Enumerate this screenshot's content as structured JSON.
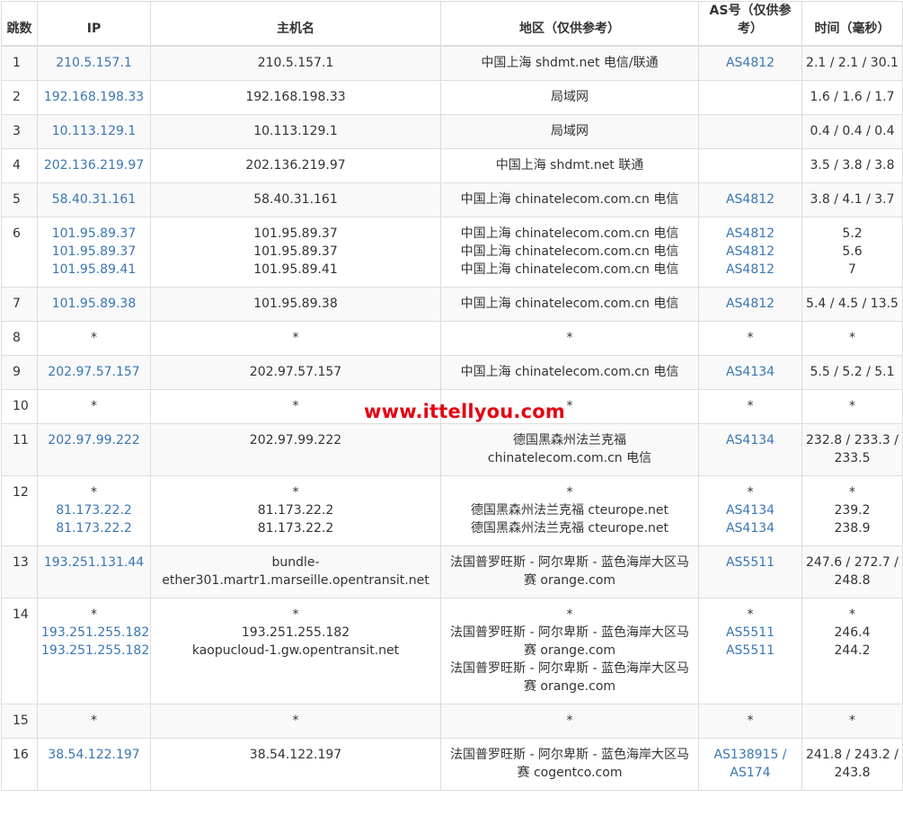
{
  "headers": {
    "hop": "跳数",
    "ip": "IP",
    "hostname": "主机名",
    "region": "地区（仅供参考）",
    "as": "AS号（仅供参考）",
    "time": "时间（毫秒）"
  },
  "watermark": "www.ittellyou.com",
  "rows": [
    {
      "hop": "1",
      "ip": [
        "210.5.157.1"
      ],
      "host": [
        "210.5.157.1"
      ],
      "region": [
        "中国上海 shdmt.net 电信/联通"
      ],
      "as": [
        "AS4812"
      ],
      "time": [
        "2.1 / 2.1 / 30.1"
      ]
    },
    {
      "hop": "2",
      "ip": [
        "192.168.198.33"
      ],
      "host": [
        "192.168.198.33"
      ],
      "region": [
        "局域网"
      ],
      "as": [
        ""
      ],
      "time": [
        "1.6 / 1.6 / 1.7"
      ]
    },
    {
      "hop": "3",
      "ip": [
        "10.113.129.1"
      ],
      "host": [
        "10.113.129.1"
      ],
      "region": [
        "局域网"
      ],
      "as": [
        ""
      ],
      "time": [
        "0.4 / 0.4 / 0.4"
      ]
    },
    {
      "hop": "4",
      "ip": [
        "202.136.219.97"
      ],
      "host": [
        "202.136.219.97"
      ],
      "region": [
        "中国上海 shdmt.net 联通"
      ],
      "as": [
        ""
      ],
      "time": [
        "3.5 / 3.8 / 3.8"
      ]
    },
    {
      "hop": "5",
      "ip": [
        "58.40.31.161"
      ],
      "host": [
        "58.40.31.161"
      ],
      "region": [
        "中国上海 chinatelecom.com.cn 电信"
      ],
      "as": [
        "AS4812"
      ],
      "time": [
        "3.8 / 4.1 / 3.7"
      ]
    },
    {
      "hop": "6",
      "ip": [
        "101.95.89.37",
        "101.95.89.37",
        "101.95.89.41"
      ],
      "host": [
        "101.95.89.37",
        "101.95.89.37",
        "101.95.89.41"
      ],
      "region": [
        "中国上海 chinatelecom.com.cn 电信",
        "中国上海 chinatelecom.com.cn 电信",
        "中国上海 chinatelecom.com.cn 电信"
      ],
      "as": [
        "AS4812",
        "AS4812",
        "AS4812"
      ],
      "time": [
        "5.2",
        "5.6",
        "7"
      ]
    },
    {
      "hop": "7",
      "ip": [
        "101.95.89.38"
      ],
      "host": [
        "101.95.89.38"
      ],
      "region": [
        "中国上海 chinatelecom.com.cn 电信"
      ],
      "as": [
        "AS4812"
      ],
      "time": [
        "5.4 / 4.5 / 13.5"
      ]
    },
    {
      "hop": "8",
      "ip": [
        "*"
      ],
      "host": [
        "*"
      ],
      "region": [
        "*"
      ],
      "as": [
        "*"
      ],
      "time": [
        "*"
      ]
    },
    {
      "hop": "9",
      "ip": [
        "202.97.57.157"
      ],
      "host": [
        "202.97.57.157"
      ],
      "region": [
        "中国上海 chinatelecom.com.cn 电信"
      ],
      "as": [
        "AS4134"
      ],
      "time": [
        "5.5 / 5.2 / 5.1"
      ]
    },
    {
      "hop": "10",
      "ip": [
        "*"
      ],
      "host": [
        "*"
      ],
      "region": [
        "*"
      ],
      "as": [
        "*"
      ],
      "time": [
        "*"
      ]
    },
    {
      "hop": "11",
      "ip": [
        "202.97.99.222"
      ],
      "host": [
        "202.97.99.222"
      ],
      "region": [
        "德国黑森州法兰克福 chinatelecom.com.cn 电信"
      ],
      "as": [
        "AS4134"
      ],
      "time": [
        "232.8 / 233.3 / 233.5"
      ]
    },
    {
      "hop": "12",
      "ip": [
        "*",
        "81.173.22.2",
        "81.173.22.2"
      ],
      "host": [
        "*",
        "81.173.22.2",
        "81.173.22.2"
      ],
      "region": [
        "*",
        "德国黑森州法兰克福 cteurope.net",
        "德国黑森州法兰克福 cteurope.net"
      ],
      "as": [
        "*",
        "AS4134",
        "AS4134"
      ],
      "time": [
        "*",
        "239.2",
        "238.9"
      ]
    },
    {
      "hop": "13",
      "ip": [
        "193.251.131.44"
      ],
      "host": [
        "bundle-ether301.martr1.marseille.opentransit.net"
      ],
      "region": [
        "法国普罗旺斯 - 阿尔卑斯 - 蓝色海岸大区马赛 orange.com"
      ],
      "as": [
        "AS5511"
      ],
      "time": [
        "247.6 / 272.7 / 248.8"
      ]
    },
    {
      "hop": "14",
      "ip": [
        "*",
        "193.251.255.182",
        "193.251.255.182"
      ],
      "host": [
        "*",
        "193.251.255.182",
        "kaopucloud-1.gw.opentransit.net"
      ],
      "region": [
        "*",
        "法国普罗旺斯 - 阿尔卑斯 - 蓝色海岸大区马赛 orange.com",
        "法国普罗旺斯 - 阿尔卑斯 - 蓝色海岸大区马赛 orange.com"
      ],
      "as": [
        "*",
        "AS5511",
        "AS5511"
      ],
      "time": [
        "*",
        "246.4",
        "244.2"
      ]
    },
    {
      "hop": "15",
      "ip": [
        "*"
      ],
      "host": [
        "*"
      ],
      "region": [
        "*"
      ],
      "as": [
        "*"
      ],
      "time": [
        "*"
      ]
    },
    {
      "hop": "16",
      "ip": [
        "38.54.122.197"
      ],
      "host": [
        "38.54.122.197"
      ],
      "region": [
        "法国普罗旺斯 - 阿尔卑斯 - 蓝色海岸大区马赛 cogentco.com"
      ],
      "as": [
        "AS138915 / AS174"
      ],
      "time": [
        "241.8 / 243.2 / 243.8"
      ]
    }
  ]
}
